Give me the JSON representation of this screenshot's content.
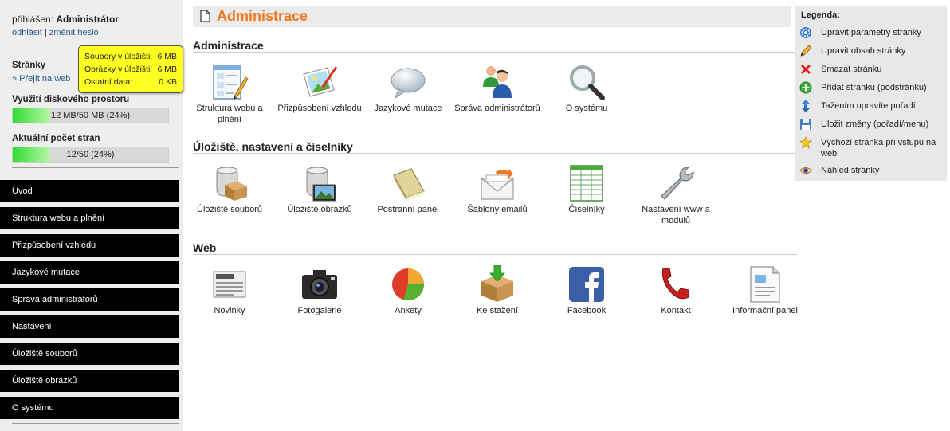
{
  "user": {
    "prefix": "přihlášen:",
    "name": "Administrátor",
    "logout": "odhlásit",
    "separator": "|",
    "change_password": "změnit heslo"
  },
  "pages_section": {
    "title": "Stránky",
    "web_link": "» Přejít na web"
  },
  "tooltip": {
    "rows": [
      {
        "label": "Soubory v úložišti:",
        "value": "6 MB"
      },
      {
        "label": "Obrázky v úložišti:",
        "value": "6 MB"
      },
      {
        "label": "Ostatní data:",
        "value": "0 KB"
      }
    ]
  },
  "disk_usage": {
    "title": "Využití diskového prostoru",
    "text": "12 MB/50 MB (24%)",
    "fraction": 0.24
  },
  "page_count": {
    "title": "Aktuální počet stran",
    "text": "12/50 (24%)",
    "fraction": 0.24
  },
  "nav": [
    "Úvod",
    "Struktura webu a plnění",
    "Přizpůsobení vzhledu",
    "Jazykové mutace",
    "Správa administrátorů",
    "Nastavení",
    "Úložiště souborů",
    "Úložiště obrázků",
    "O systému"
  ],
  "header": {
    "title": "Administrace"
  },
  "sections": [
    {
      "title": "Administrace",
      "items": [
        {
          "label": "Struktura webu a plnění",
          "icon": "site-structure-icon"
        },
        {
          "label": "Přizpůsobení vzhledu",
          "icon": "appearance-icon"
        },
        {
          "label": "Jazykové mutace",
          "icon": "speech-bubble-icon"
        },
        {
          "label": "Správa administrátorů",
          "icon": "admin-users-icon"
        },
        {
          "label": "O systému",
          "icon": "magnifier-icon"
        }
      ]
    },
    {
      "title": "Úložiště, nastavení a číselníky",
      "items": [
        {
          "label": "Úložiště souborů",
          "icon": "file-storage-icon"
        },
        {
          "label": "Úložiště obrázků",
          "icon": "image-storage-icon"
        },
        {
          "label": "Postranní panel",
          "icon": "book-icon"
        },
        {
          "label": "Šablony emailů",
          "icon": "email-icon"
        },
        {
          "label": "Číselníky",
          "icon": "table-icon"
        },
        {
          "label": "Nastavení www a modulů",
          "icon": "wrench-icon"
        }
      ]
    },
    {
      "title": "Web",
      "items": [
        {
          "label": "Novinky",
          "icon": "newspaper-icon"
        },
        {
          "label": "Fotogalerie",
          "icon": "camera-icon"
        },
        {
          "label": "Ankety",
          "icon": "pie-chart-icon"
        },
        {
          "label": "Ke stažení",
          "icon": "download-box-icon"
        },
        {
          "label": "Facebook",
          "icon": "facebook-icon"
        },
        {
          "label": "Kontakt",
          "icon": "phone-icon"
        },
        {
          "label": "Informační panel",
          "icon": "info-panel-icon"
        }
      ]
    }
  ],
  "legend": {
    "title": "Legenda:",
    "items": [
      {
        "text": "Upravit parametry stránky",
        "icon": "gear-icon"
      },
      {
        "text": "Upravit obsah stránky",
        "icon": "pencil-icon"
      },
      {
        "text": "Smazat stránku",
        "icon": "delete-icon"
      },
      {
        "text": "Přidat stránku (podstránku)",
        "icon": "add-icon"
      },
      {
        "text": "Tažením upravíte pořadí",
        "icon": "sort-arrows-icon"
      },
      {
        "text": "Uložit změny (pořadí/menu)",
        "icon": "save-icon"
      },
      {
        "text": "Výchozí stránka při vstupu na web",
        "icon": "star-icon"
      },
      {
        "text": "Náhled stránky",
        "icon": "eye-icon"
      }
    ]
  },
  "colors": {
    "accent": "#f07820",
    "nav_bg": "#000000",
    "sidebar_bg": "#eeeeee",
    "tooltip_bg": "#ffff22",
    "bar_fill": "#33dd33"
  }
}
